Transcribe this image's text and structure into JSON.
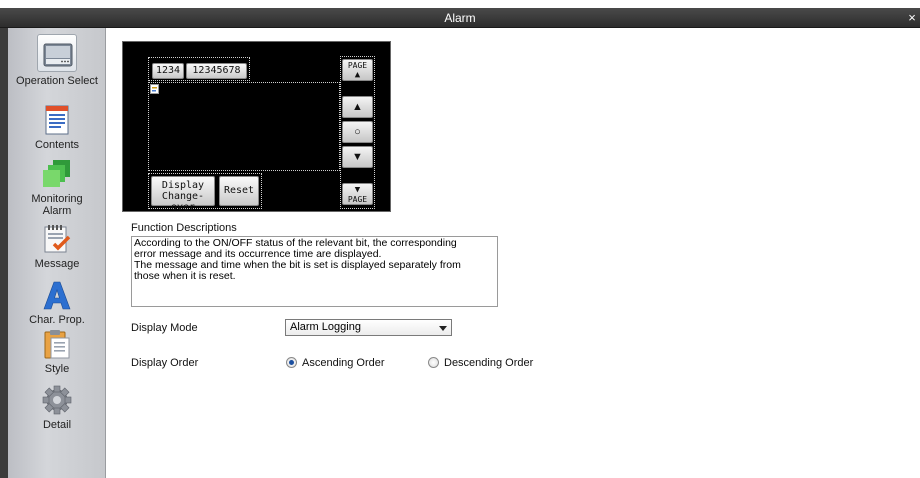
{
  "window": {
    "title": "Alarm",
    "close_glyph": "×"
  },
  "sidebar": {
    "items": [
      {
        "label": "Operation Select",
        "icon": "operation-select-icon"
      },
      {
        "label": "Contents",
        "icon": "contents-icon"
      },
      {
        "label": "Monitoring Alarm",
        "icon": "monitoring-alarm-icon"
      },
      {
        "label": "Message",
        "icon": "message-icon"
      },
      {
        "label": "Char. Prop.",
        "icon": "char-prop-icon"
      },
      {
        "label": "Style",
        "icon": "style-icon"
      },
      {
        "label": "Detail",
        "icon": "detail-icon"
      }
    ]
  },
  "preview": {
    "tab1": "1234",
    "tab2": "12345678",
    "page_label": "PAGE",
    "up_glyph": "▲",
    "center_glyph": "○",
    "down_glyph": "▼",
    "display_changeover": "Display\nChange-over",
    "reset": "Reset"
  },
  "function": {
    "label": "Function Descriptions",
    "text": "According to the ON/OFF status of the relevant bit, the corresponding\nerror message and its occurrence time are displayed.\nThe message and time when the bit is set is displayed separately from\nthose when it is reset."
  },
  "display_mode": {
    "label": "Display Mode",
    "value": "Alarm Logging"
  },
  "display_order": {
    "label": "Display Order",
    "options": [
      "Ascending Order",
      "Descending Order"
    ],
    "selected": "Ascending Order"
  }
}
